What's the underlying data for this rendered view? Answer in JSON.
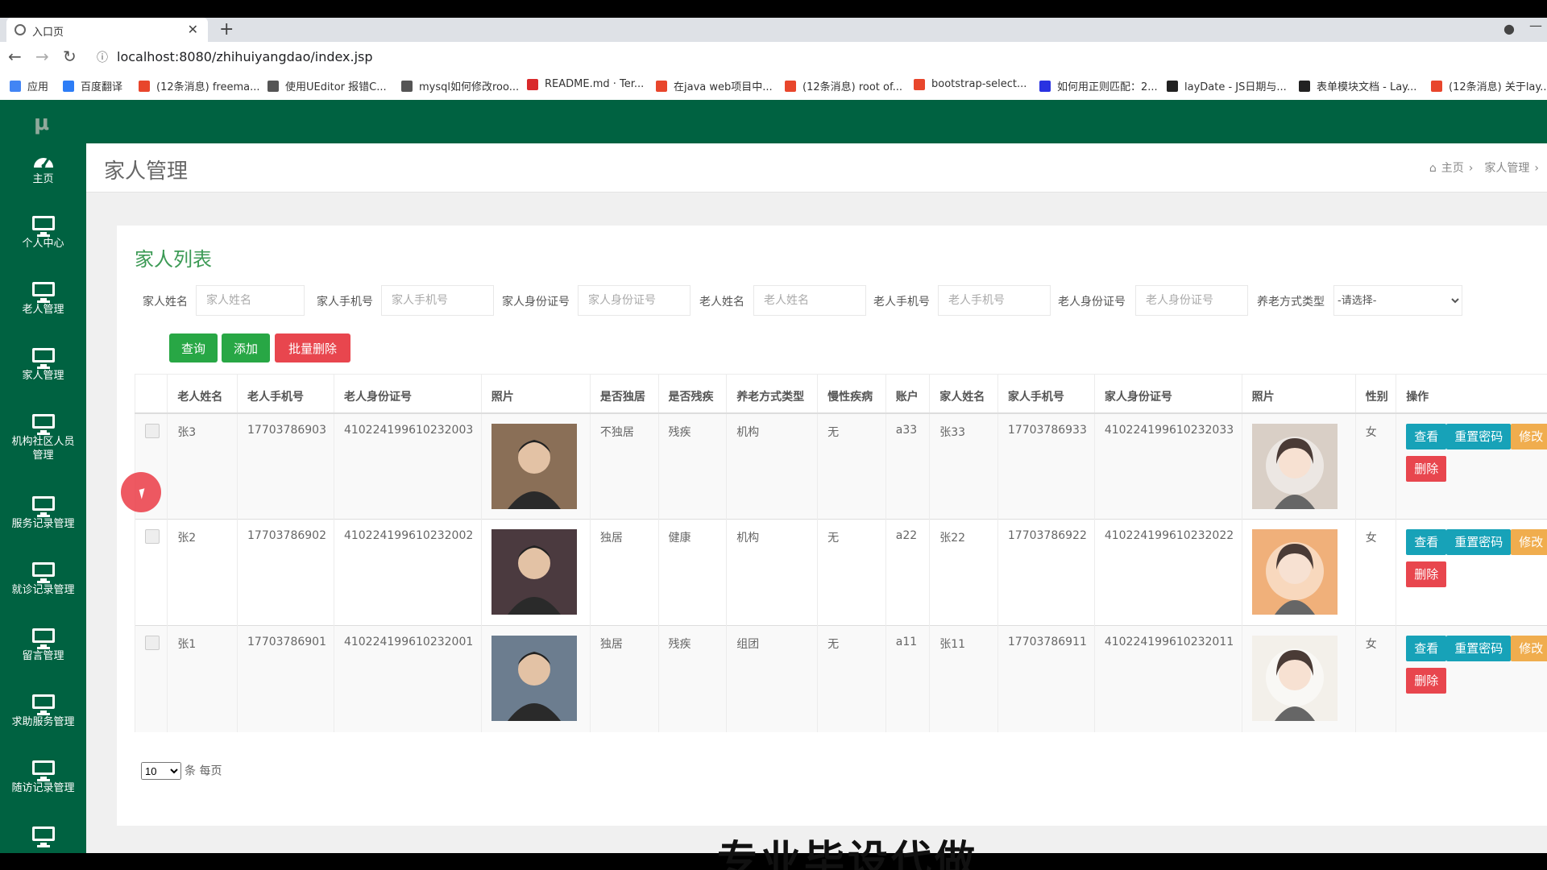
{
  "browser": {
    "tab_title": "入口页",
    "url": "localhost:8080/zhihuiyangdao/index.jsp",
    "bookmarks": [
      {
        "label": "应用",
        "color": "#4285f4"
      },
      {
        "label": "百度翻译",
        "color": "#2d7df6"
      },
      {
        "label": "(12条消息) freema...",
        "color": "#e8462c"
      },
      {
        "label": "使用UEditor 报错C...",
        "color": "#555555"
      },
      {
        "label": "mysql如何修改roo...",
        "color": "#555555"
      },
      {
        "label": "README.md · Ter...",
        "color": "#d9292b"
      },
      {
        "label": "在java web项目中...",
        "color": "#e8462c"
      },
      {
        "label": "(12条消息) root of...",
        "color": "#e8462c"
      },
      {
        "label": "bootstrap-select...",
        "color": "#e8462c"
      },
      {
        "label": "如何用正则匹配：2...",
        "color": "#2932e1"
      },
      {
        "label": "layDate - JS日期与...",
        "color": "#222222"
      },
      {
        "label": "表单模块文档 - Lay...",
        "color": "#222222"
      },
      {
        "label": "(12条消息) 关于lay...",
        "color": "#e8462c"
      }
    ]
  },
  "app": {
    "logo": "μ",
    "brand_color": "#006241",
    "sidebar": [
      {
        "label": "主页",
        "icon": "dashboard-icon"
      },
      {
        "label": "个人中心",
        "icon": "monitor-icon"
      },
      {
        "label": "老人管理",
        "icon": "monitor-icon"
      },
      {
        "label": "家人管理",
        "icon": "monitor-icon"
      },
      {
        "label": "机构社区人员管理",
        "icon": "monitor-icon"
      },
      {
        "label": "服务记录管理",
        "icon": "monitor-icon"
      },
      {
        "label": "就诊记录管理",
        "icon": "monitor-icon"
      },
      {
        "label": "留言管理",
        "icon": "monitor-icon"
      },
      {
        "label": "求助服务管理",
        "icon": "monitor-icon"
      },
      {
        "label": "随访记录管理",
        "icon": "monitor-icon"
      },
      {
        "label": "",
        "icon": "monitor-icon"
      }
    ],
    "page_title": "家人管理",
    "breadcrumb": {
      "home": "主页",
      "current": "家人管理"
    }
  },
  "panel": {
    "title": "家人列表",
    "filters": [
      {
        "label": "家人姓名",
        "placeholder": "家人姓名"
      },
      {
        "label": "家人手机号",
        "placeholder": "家人手机号"
      },
      {
        "label": "家人身份证号",
        "placeholder": "家人身份证号"
      },
      {
        "label": "老人姓名",
        "placeholder": "老人姓名"
      },
      {
        "label": "老人手机号",
        "placeholder": "老人手机号"
      },
      {
        "label": "老人身份证号",
        "placeholder": "老人身份证号"
      }
    ],
    "type_filter": {
      "label": "养老方式类型",
      "selected": "-请选择-"
    },
    "buttons": {
      "query": "查询",
      "add": "添加",
      "batch_delete": "批量删除"
    },
    "columns": [
      "老人姓名",
      "老人手机号",
      "老人身份证号",
      "照片",
      "是否独居",
      "是否残疾",
      "养老方式类型",
      "慢性疾病",
      "账户",
      "家人姓名",
      "家人手机号",
      "家人身份证号",
      "照片",
      "性别",
      "操作"
    ],
    "rows": [
      {
        "elder_name": "张3",
        "elder_phone": "17703786903",
        "elder_id": "410224199610232003",
        "alone": "不独居",
        "disabled": "残疾",
        "care_type": "机构",
        "chronic": "无",
        "account": "a33",
        "family_name": "张33",
        "family_phone": "17703786933",
        "family_id": "410224199610232033",
        "gender": "女"
      },
      {
        "elder_name": "张2",
        "elder_phone": "17703786902",
        "elder_id": "410224199610232002",
        "alone": "独居",
        "disabled": "健康",
        "care_type": "机构",
        "chronic": "无",
        "account": "a22",
        "family_name": "张22",
        "family_phone": "17703786922",
        "family_id": "410224199610232022",
        "gender": "女"
      },
      {
        "elder_name": "张1",
        "elder_phone": "17703786901",
        "elder_id": "410224199610232001",
        "alone": "独居",
        "disabled": "残疾",
        "care_type": "组团",
        "chronic": "无",
        "account": "a11",
        "family_name": "张11",
        "family_phone": "17703786911",
        "family_id": "410224199610232011",
        "gender": "女"
      }
    ],
    "ops": {
      "view": "查看",
      "reset": "重置密码",
      "edit": "修改",
      "delete": "删除"
    },
    "pager": {
      "page_size": "10",
      "suffix": "条 每页"
    }
  },
  "overlay": {
    "subtitle": "专业毕设代做"
  }
}
